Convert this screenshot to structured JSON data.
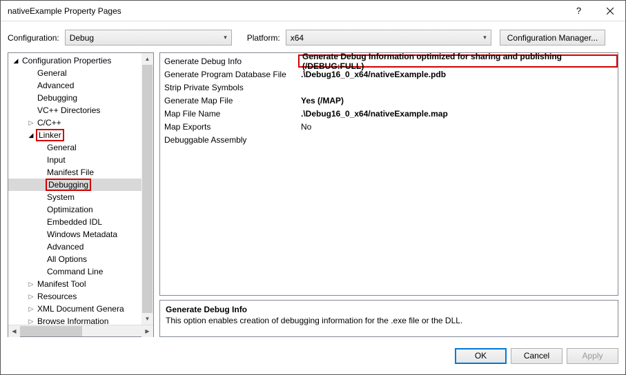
{
  "window": {
    "title": "nativeExample Property Pages"
  },
  "toolbar": {
    "config_label": "Configuration:",
    "config_value": "Debug",
    "platform_label": "Platform:",
    "platform_value": "x64",
    "config_mgr": "Configuration Manager..."
  },
  "tree": {
    "root": "Configuration Properties",
    "items": [
      "General",
      "Advanced",
      "Debugging",
      "VC++ Directories"
    ],
    "cpp": "C/C++",
    "linker": "Linker",
    "linker_items": [
      "General",
      "Input",
      "Manifest File",
      "Debugging",
      "System",
      "Optimization",
      "Embedded IDL",
      "Windows Metadata",
      "Advanced",
      "All Options",
      "Command Line"
    ],
    "rest": [
      "Manifest Tool",
      "Resources",
      "XML Document Genera",
      "Browse Information"
    ]
  },
  "grid": {
    "rows": [
      {
        "name": "Generate Debug Info",
        "val": "Generate Debug Information optimized for sharing and publishing (/DEBUG:FULL)",
        "bold": true,
        "red": true
      },
      {
        "name": "Generate Program Database File",
        "val": ".\\Debug16_0_x64/nativeExample.pdb",
        "bold": true
      },
      {
        "name": "Strip Private Symbols",
        "val": ""
      },
      {
        "name": "Generate Map File",
        "val": "Yes (/MAP)",
        "bold": true
      },
      {
        "name": "Map File Name",
        "val": ".\\Debug16_0_x64/nativeExample.map",
        "bold": true
      },
      {
        "name": "Map Exports",
        "val": "No"
      },
      {
        "name": "Debuggable Assembly",
        "val": ""
      }
    ]
  },
  "desc": {
    "title": "Generate Debug Info",
    "body": "This option enables creation of debugging information for the .exe file or the DLL."
  },
  "footer": {
    "ok": "OK",
    "cancel": "Cancel",
    "apply": "Apply"
  }
}
